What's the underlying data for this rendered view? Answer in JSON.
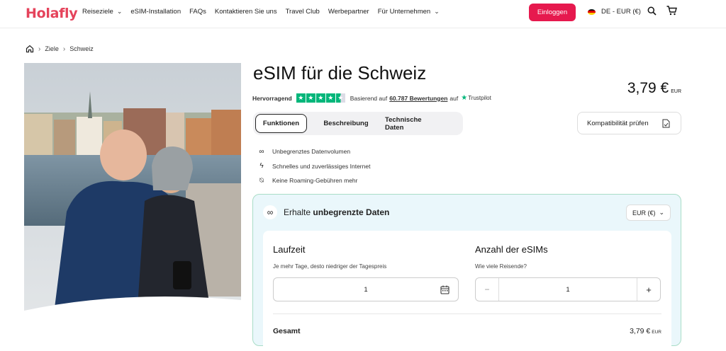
{
  "header": {
    "logo": "Holafly",
    "nav": [
      {
        "label": "Reiseziele",
        "chevron": true
      },
      {
        "label": "eSIM-Installation",
        "chevron": false
      },
      {
        "label": "FAQs",
        "chevron": false
      },
      {
        "label": "Kontaktieren Sie uns",
        "chevron": false
      },
      {
        "label": "Travel Club",
        "chevron": false
      },
      {
        "label": "Werbepartner",
        "chevron": false
      },
      {
        "label": "Für Unternehmen",
        "chevron": true
      }
    ],
    "login_label": "Einloggen",
    "locale_label": "DE - EUR (€)",
    "icons": [
      "search-icon",
      "cart-icon"
    ]
  },
  "breadcrumb": {
    "items": [
      "Ziele",
      "Schweiz"
    ]
  },
  "product": {
    "title": "eSIM für die Schweiz",
    "price": "3,79 €",
    "price_currency": "EUR",
    "rating_label": "Hervorragend",
    "rating_stars": 4.5,
    "reviews_prefix": "Basierend auf",
    "reviews_link": "60.787 Bewertungen",
    "reviews_suffix": "auf",
    "trustpilot": "Trustpilot"
  },
  "tabs": [
    {
      "label": "Funktionen",
      "active": true
    },
    {
      "label": "Beschreibung",
      "active": false
    },
    {
      "label": "Technische Daten",
      "active": false
    }
  ],
  "compat_label": "Kompatibilität prüfen",
  "features": [
    {
      "icon": "infinity-icon",
      "text": "Unbegrenztes Datenvolumen"
    },
    {
      "icon": "lightning-icon",
      "text": "Schnelles und zuverlässiges Internet"
    },
    {
      "icon": "no-roaming-icon",
      "text": "Keine Roaming-Gebühren mehr"
    }
  ],
  "plan": {
    "head_prefix": "Erhalte",
    "head_bold": "unbegrenzte Daten",
    "currency_select": "EUR (€)",
    "duration_title": "Laufzeit",
    "duration_sub": "Je mehr Tage, desto niedriger der Tagespreis",
    "duration_value": "1",
    "count_title": "Anzahl der eSIMs",
    "count_sub": "Wie viele Reisende?",
    "count_value": "1",
    "minus": "−",
    "plus": "+",
    "total_label": "Gesamt",
    "total_value": "3,79 €",
    "total_currency": "EUR"
  },
  "colors": {
    "brand": "#e6194e",
    "trustpilot": "#00b67a",
    "panel_bg": "#eaf7fb",
    "panel_border": "#a9ddc7"
  }
}
